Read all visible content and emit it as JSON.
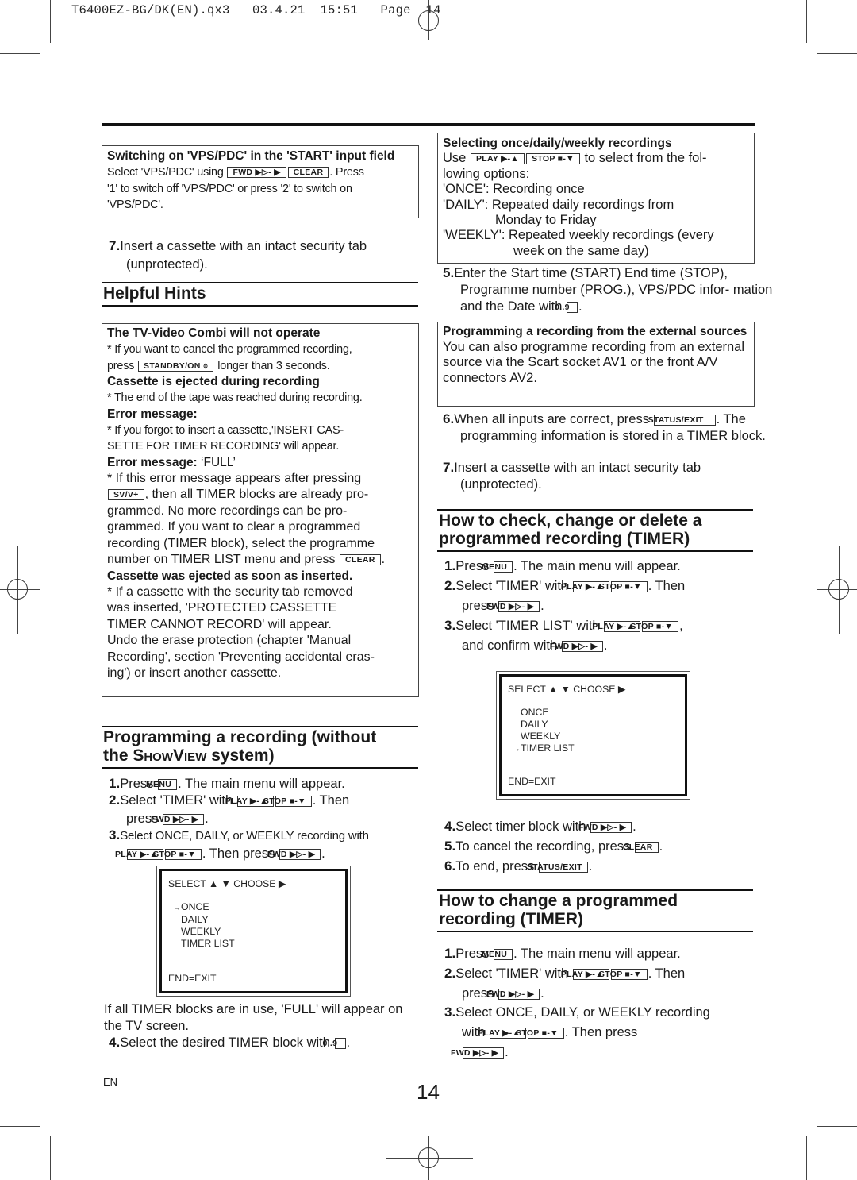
{
  "slug": "T6400EZ-BG/DK(EN).qx3   03.4.21  15:51   Page  14",
  "buttons": {
    "fwd": "FWD ▶▷- ▶",
    "clear": "CLEAR",
    "play": "PLAY ▶-▲",
    "stop": "STOP ■-▼",
    "menu": "MENU",
    "standby": "STANDBY/ON ⌽",
    "svv": "SV/V+",
    "digits": "0..9",
    "status_exit": "STATUS/EXIT"
  },
  "left": {
    "vps_box": {
      "title": "Switching on 'VPS/PDC' in the 'START' input field",
      "t1": "Select 'VPS/PDC' using",
      "t2": ". Press",
      "t3": "'1' to switch off 'VPS/PDC' or press '2' to switch on",
      "t4": "'VPS/PDC'."
    },
    "step7": {
      "num": "7.",
      "text": "Insert a cassette with an intact security tab (unprotected)."
    },
    "hints_heading": "Helpful Hints",
    "hints": {
      "h1": "The TV-Video Combi will not operate",
      "h1_t1": "* If you want to cancel the programmed recording,",
      "h1_t2a": "press",
      "h1_t2b": "longer than 3 seconds.",
      "h2": "Cassette is ejected during recording",
      "h2_t": "* The end of the tape was reached during recording.",
      "h3": "Error message:",
      "h3_t1": "* If you forgot to insert a cassette,'INSERT CAS-",
      "h3_t2": "SETTE FOR TIMER RECORDING' will appear.",
      "h4": "Error message: ",
      "h4_val": "‘FULL’",
      "h4_t1": "* If this error message appears after pressing",
      "h4_t2": ", then all TIMER blocks are already pro-",
      "h4_t3": "grammed. No more recordings can be pro-",
      "h4_t4": "grammed. If you want to clear a programmed",
      "h4_t5": "recording (TIMER block), select the programme",
      "h4_t6": "number on TIMER LIST menu and press",
      "h5": "Cassette was ejected as soon as inserted.",
      "h5_t1": "* If a cassette with the security tab removed",
      "h5_t2": "was inserted, 'PROTECTED CASSETTE",
      "h5_t3": "TIMER CANNOT RECORD' will appear.",
      "h5_t4": "Undo the erase protection (chapter 'Manual",
      "h5_t5": "Recording', section 'Preventing accidental eras-",
      "h5_t6": "ing') or insert another cassette."
    },
    "prog_heading_1": "Programming a recording (without",
    "prog_heading_2a": "the ",
    "prog_heading_2b": "ShowView",
    "prog_heading_2c": " system)",
    "steps": {
      "s1_num": "1.",
      "s1a": "Press",
      "s1b": ". The main menu will appear.",
      "s2_num": "2.",
      "s2a": "Select 'TIMER' with",
      "s2b": ". Then",
      "s2c": "press",
      "s2d": ".",
      "s3_num": "3.",
      "s3a": "Select ONCE, DAILY, or WEEKLY recording with",
      "s3b": ". Then press",
      "s3c": ".",
      "full_note": "If all TIMER blocks are in use, 'FULL' will appear on the TV screen.",
      "s4_num": "4.",
      "s4a": "Select the desired TIMER block with",
      "s4b": "."
    },
    "screen": {
      "header": "SELECT ▲ ▼  CHOOSE ▶",
      "items": [
        "ONCE",
        "DAILY",
        "WEEKLY",
        "TIMER LIST"
      ],
      "selected_index": 0,
      "arrow": "→",
      "exit": "END=EXIT"
    }
  },
  "right": {
    "select_box": {
      "title": "Selecting once/daily/weekly recordings",
      "t1a": "Use",
      "t1b": "to select from the fol-",
      "t2": "lowing options:",
      "once": "'ONCE': Recording once",
      "daily1": "'DAILY': Repeated daily recordings from",
      "daily2": "Monday to Friday",
      "weekly1": "'WEEKLY': Repeated weekly recordings (every",
      "weekly2": "week on the same day)"
    },
    "step5": {
      "num": "5.",
      "a": "Enter the Start time (START) End time (STOP), Programme number (PROG.), VPS/PDC infor- mation and the Date with",
      "b": "."
    },
    "ext_box": {
      "title": "Programming a recording from the external sources",
      "text": "You can also programme recording from an external source via the Scart socket AV1 or the front A/V connectors AV2."
    },
    "step6": {
      "num": "6.",
      "a": "When all inputs are correct, press",
      "b": ". The programming information is stored in a TIMER block."
    },
    "step7": {
      "num": "7.",
      "text": "Insert a cassette with an intact security tab (unprotected)."
    },
    "check_heading_1": "How to check, change or delete a",
    "check_heading_2": "programmed recording (TIMER)",
    "check": {
      "s1_num": "1.",
      "s1a": "Press",
      "s1b": ". The main menu will appear.",
      "s2_num": "2.",
      "s2a": "Select 'TIMER' with",
      "s2b": ". Then",
      "s2c": "press",
      "s2d": ".",
      "s3_num": "3.",
      "s3a": "Select 'TIMER LIST' with",
      "s3b": ",",
      "s3c": "and confirm with",
      "s3d": ".",
      "s4_num": "4.",
      "s4a": "Select timer block with",
      "s4b": ".",
      "s5_num": "5.",
      "s5a": "To cancel the recording, press",
      "s5b": ".",
      "s6_num": "6.",
      "s6a": "To end, press",
      "s6b": "."
    },
    "screen": {
      "header": "SELECT ▲ ▼  CHOOSE ▶",
      "items": [
        "ONCE",
        "DAILY",
        "WEEKLY",
        "TIMER LIST"
      ],
      "selected_index": 3,
      "arrow": "→",
      "exit": "END=EXIT"
    },
    "change_heading_1": "How to change a programmed",
    "change_heading_2": "recording (TIMER)",
    "change": {
      "s1_num": "1.",
      "s1a": "Press",
      "s1b": ". The main menu will appear.",
      "s2_num": "2.",
      "s2a": "Select 'TIMER' with",
      "s2b": ". Then",
      "s2c": "press",
      "s2d": ".",
      "s3_num": "3.",
      "s3a": "Select ONCE, DAILY, or WEEKLY recording",
      "s3b": "with",
      "s3c": ". Then press",
      "s3d": "."
    }
  },
  "footer": {
    "lang": "EN",
    "page_number": "14"
  }
}
